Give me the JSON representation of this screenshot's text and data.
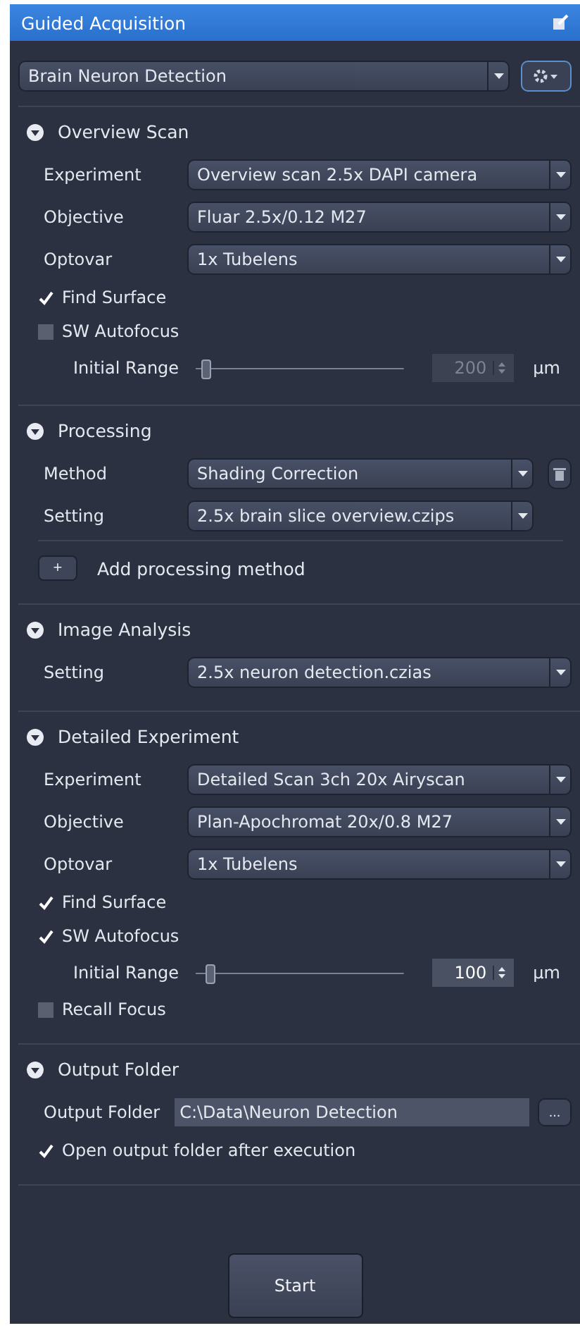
{
  "window": {
    "title": "Guided Acquisition"
  },
  "preset": {
    "value": "Brain Neuron Detection"
  },
  "sections": [
    {
      "title": "Overview Scan",
      "expanded": true,
      "rows": [
        {
          "kind": "select",
          "label": "Experiment",
          "value": "Overview scan 2.5x DAPI camera"
        },
        {
          "kind": "select",
          "label": "Objective",
          "value": "Fluar 2.5x/0.12 M27"
        },
        {
          "kind": "select",
          "label": "Optovar",
          "value": "1x Tubelens"
        },
        {
          "kind": "checkbox",
          "label": "Find Surface",
          "checked": true
        },
        {
          "kind": "checkbox",
          "label": "SW Autofocus",
          "checked": false
        },
        {
          "kind": "range",
          "label": "Initial Range",
          "level": 0.03,
          "value": "200",
          "unit": "µm",
          "disabled": true
        }
      ]
    },
    {
      "title": "Processing",
      "expanded": true,
      "rows": [
        {
          "kind": "select",
          "label": "Method",
          "value": "Shading Correction",
          "narrow": true,
          "delete": true
        },
        {
          "kind": "select",
          "label": "Setting",
          "value": "2.5x brain slice overview.czips",
          "narrow": true
        },
        {
          "kind": "add",
          "icon": "+",
          "label": "Add processing method"
        }
      ]
    },
    {
      "title": "Image Analysis",
      "expanded": true,
      "rows": [
        {
          "kind": "select",
          "label": "Setting",
          "value": "2.5x neuron detection.czias"
        }
      ]
    },
    {
      "title": "Detailed Experiment",
      "expanded": true,
      "rows": [
        {
          "kind": "select",
          "label": "Experiment",
          "value": "Detailed Scan 3ch 20x Airyscan"
        },
        {
          "kind": "select",
          "label": "Objective",
          "value": "Plan-Apochromat 20x/0.8 M27"
        },
        {
          "kind": "select",
          "label": "Optovar",
          "value": "1x Tubelens"
        },
        {
          "kind": "checkbox",
          "label": "Find Surface",
          "checked": true
        },
        {
          "kind": "checkbox",
          "label": "SW Autofocus",
          "checked": true
        },
        {
          "kind": "range",
          "label": "Initial Range",
          "level": 0.05,
          "value": "100",
          "unit": "µm",
          "disabled": false
        },
        {
          "kind": "checkbox",
          "label": "Recall Focus",
          "checked": false
        }
      ]
    },
    {
      "title": "Output Folder",
      "expanded": true,
      "rows": [
        {
          "kind": "folder",
          "label": "Output Folder",
          "value": "C:\\Data\\Neuron Detection",
          "browse": "..."
        },
        {
          "kind": "checkbox",
          "label": "Open output folder after execution",
          "checked": true
        }
      ]
    }
  ],
  "start_button": "Start"
}
